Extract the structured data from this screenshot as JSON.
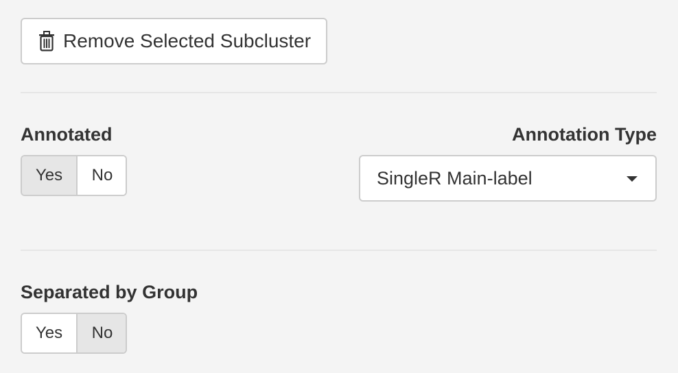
{
  "remove_button": {
    "label": "Remove Selected Subcluster",
    "icon": "trash-icon"
  },
  "annotated": {
    "label": "Annotated",
    "options": [
      "Yes",
      "No"
    ],
    "selected": "Yes"
  },
  "annotation_type": {
    "label": "Annotation Type",
    "selected_value": "SingleR Main-label",
    "icon": "caret-down-icon"
  },
  "separated_by_group": {
    "label": "Separated by Group",
    "options": [
      "Yes",
      "No"
    ],
    "selected": "No"
  },
  "colors": {
    "background": "#f4f4f4",
    "active_option": "#e6e6e6",
    "border": "#cccccc",
    "text": "#333333"
  }
}
